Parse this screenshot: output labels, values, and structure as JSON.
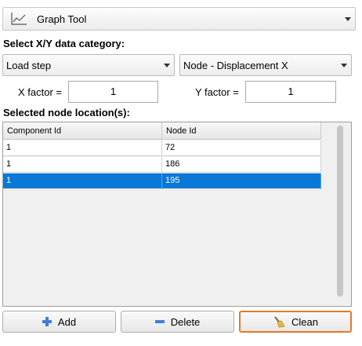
{
  "tool_select": {
    "label": "Graph Tool",
    "icon": "line-chart-icon"
  },
  "xy_section": {
    "title": "Select X/Y data category:",
    "x_category": "Load step",
    "y_category": "Node - Displacement X"
  },
  "factors": {
    "x_label": "X factor =",
    "x_value": "1",
    "y_label": "Y factor =",
    "y_value": "1"
  },
  "nodes_section": {
    "title": "Selected node location(s):",
    "columns": [
      "Component Id",
      "Node Id"
    ],
    "rows": [
      {
        "component_id": "1",
        "node_id": "72"
      },
      {
        "component_id": "1",
        "node_id": "186"
      },
      {
        "component_id": "1",
        "node_id": "195",
        "selected": true
      }
    ]
  },
  "buttons": {
    "add": "Add",
    "delete": "Delete",
    "clean": "Clean"
  },
  "colors": {
    "selection": "#0a78d7",
    "focus_border": "#e07b28",
    "icon_blue": "#3f7fd6"
  }
}
